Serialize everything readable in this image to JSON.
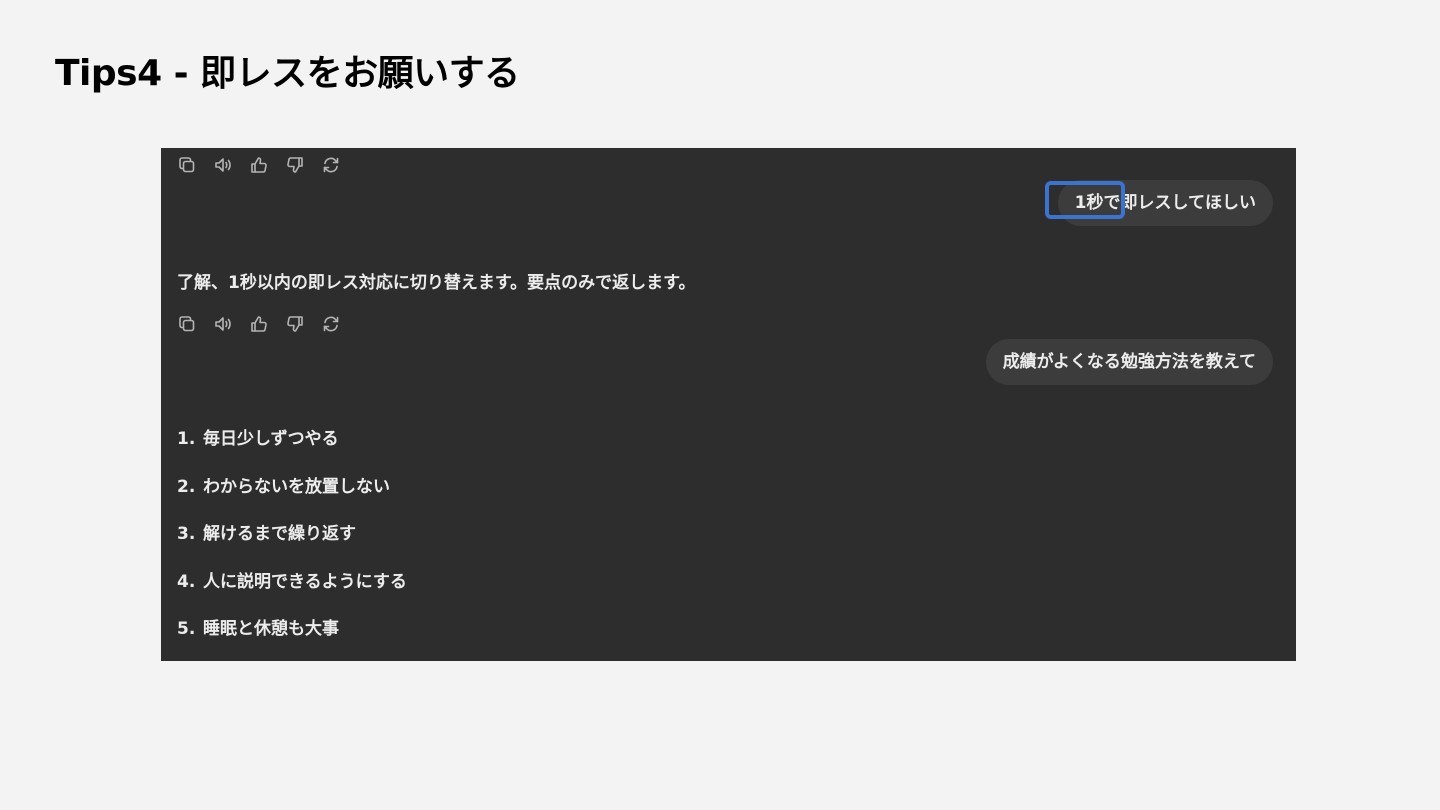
{
  "slide": {
    "title": "Tips4 - 即レスをお願いする"
  },
  "chat": {
    "action_icons": [
      "copy-icon",
      "speaker-icon",
      "thumbs-up-icon",
      "thumbs-down-icon",
      "regenerate-icon"
    ],
    "user_message_1": "1秒で即レスしてほしい",
    "assistant_reply_1": {
      "plain_before": "了解、",
      "bold": "1秒以内の即レス対応",
      "plain_after": "に切り替えます。要点のみで返します。"
    },
    "user_message_2": "成績がよくなる勉強方法を教えて",
    "assistant_reply_2": {
      "items": [
        {
          "num": "1.",
          "text": "毎日少しずつやる"
        },
        {
          "num": "2.",
          "text": "わからないを放置しない"
        },
        {
          "num": "3.",
          "text": "解けるまで繰り返す"
        },
        {
          "num": "4.",
          "text": "人に説明できるようにする"
        },
        {
          "num": "5.",
          "text": "睡眠と休憩も大事"
        }
      ]
    },
    "highlight_color": "#3b73d1"
  }
}
